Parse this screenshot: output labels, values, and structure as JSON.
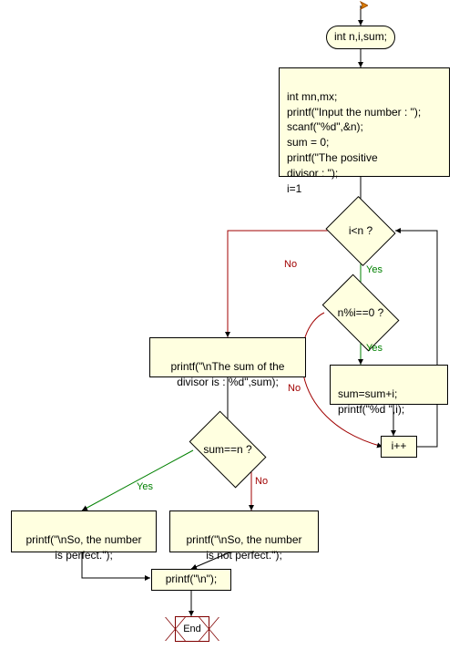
{
  "start_decl": "int n,i,sum;",
  "init_block": "int mn,mx;\nprintf(\"Input the  number : \");\nscanf(\"%d\",&n);\nsum = 0;\nprintf(\"The positive\ndivisor  : \");\ni=1",
  "cond_loop": "i<n ?",
  "cond_mod": "n%i==0 ?",
  "accum_block": "sum=sum+i;\nprintf(\"%d   \",i);",
  "inc_block": "i++",
  "print_sum": "printf(\"\\nThe sum of the\ndivisor is : %d\",sum);",
  "cond_perfect": "sum==n ?",
  "print_perfect": "printf(\"\\nSo, the number\nis perfect.\");",
  "print_notperfect": "printf(\"\\nSo, the number\nis not perfect.\");",
  "print_newline": "printf(\"\\n\");",
  "end_label": "End",
  "labels": {
    "yes": "Yes",
    "no": "No"
  },
  "chart_data": {
    "type": "flowchart",
    "nodes": [
      {
        "id": "start",
        "shape": "terminator",
        "text": "int n,i,sum;"
      },
      {
        "id": "init",
        "shape": "process",
        "text": "int mn,mx; printf(\"Input the  number : \"); scanf(\"%d\",&n); sum = 0; printf(\"The positive divisor  : \"); i=1"
      },
      {
        "id": "cond_loop",
        "shape": "decision",
        "text": "i<n ?"
      },
      {
        "id": "cond_mod",
        "shape": "decision",
        "text": "n%i==0 ?"
      },
      {
        "id": "accum",
        "shape": "process",
        "text": "sum=sum+i; printf(\"%d   \",i);"
      },
      {
        "id": "inc",
        "shape": "process",
        "text": "i++"
      },
      {
        "id": "print_sum",
        "shape": "process",
        "text": "printf(\"\\nThe sum of the divisor is : %d\",sum);"
      },
      {
        "id": "cond_perfect",
        "shape": "decision",
        "text": "sum==n ?"
      },
      {
        "id": "print_perfect",
        "shape": "process",
        "text": "printf(\"\\nSo, the number is perfect.\");"
      },
      {
        "id": "print_notperfect",
        "shape": "process",
        "text": "printf(\"\\nSo, the number is not perfect.\");"
      },
      {
        "id": "print_nl",
        "shape": "process",
        "text": "printf(\"\\n\");"
      },
      {
        "id": "end",
        "shape": "terminator",
        "text": "End"
      }
    ],
    "edges": [
      {
        "from": "start",
        "to": "init"
      },
      {
        "from": "init",
        "to": "cond_loop"
      },
      {
        "from": "cond_loop",
        "to": "cond_mod",
        "label": "Yes"
      },
      {
        "from": "cond_loop",
        "to": "print_sum",
        "label": "No"
      },
      {
        "from": "cond_mod",
        "to": "accum",
        "label": "Yes"
      },
      {
        "from": "cond_mod",
        "to": "inc",
        "label": "No"
      },
      {
        "from": "accum",
        "to": "inc"
      },
      {
        "from": "inc",
        "to": "cond_loop"
      },
      {
        "from": "print_sum",
        "to": "cond_perfect"
      },
      {
        "from": "cond_perfect",
        "to": "print_perfect",
        "label": "Yes"
      },
      {
        "from": "cond_perfect",
        "to": "print_notperfect",
        "label": "No"
      },
      {
        "from": "print_perfect",
        "to": "print_nl"
      },
      {
        "from": "print_notperfect",
        "to": "print_nl"
      },
      {
        "from": "print_nl",
        "to": "end"
      }
    ]
  }
}
